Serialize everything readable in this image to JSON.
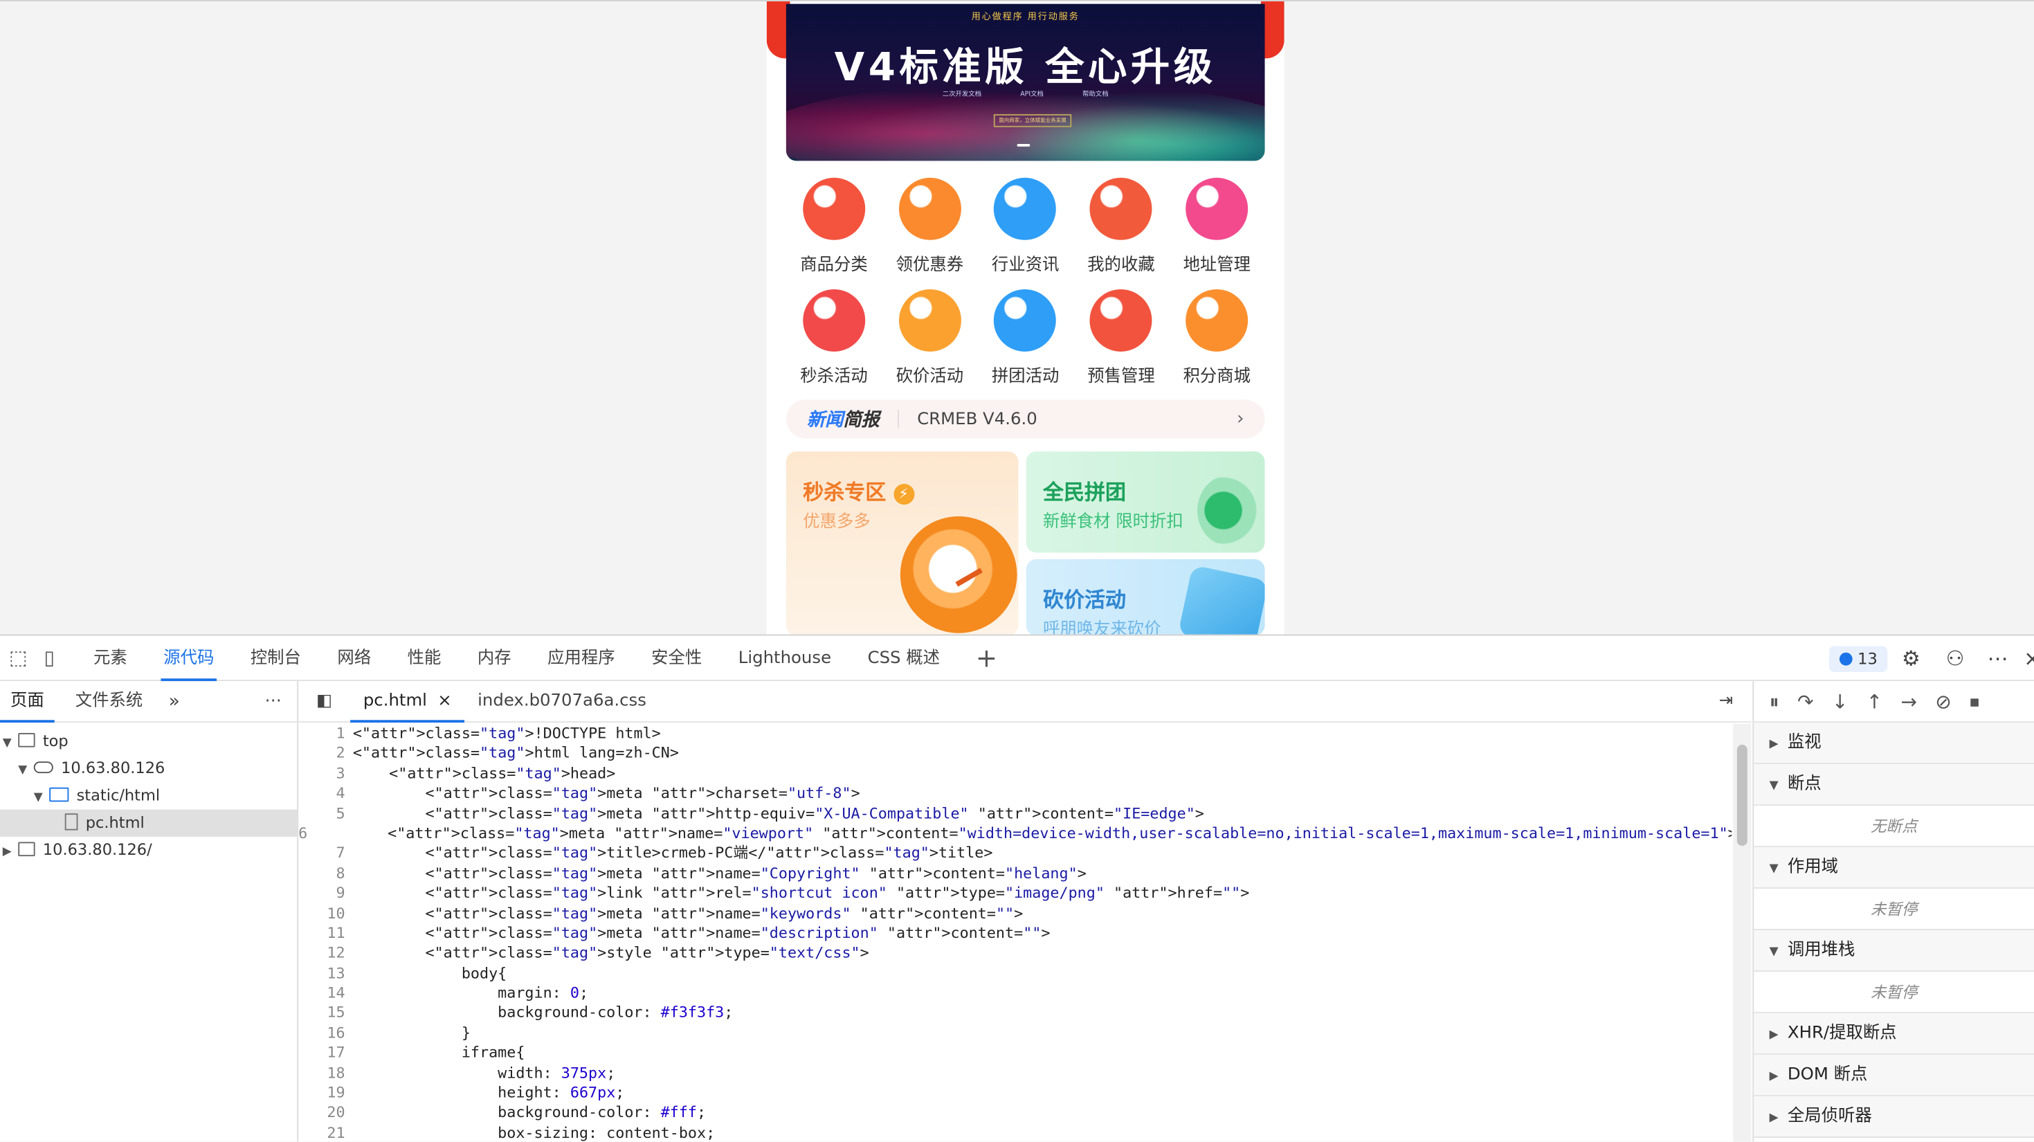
{
  "page": {
    "banner": {
      "slogan": "用心做程序 用行动服务",
      "title": "V4标准版 全心升级",
      "links": [
        "二次开发文档",
        "API文档",
        "帮助文档"
      ],
      "note": "面向商家，立体赋能业务发展"
    },
    "nav_row1": [
      {
        "label": "商品分类",
        "icon": "shopping-bag-icon",
        "color": "#f4533e"
      },
      {
        "label": "领优惠券",
        "icon": "coupon-icon",
        "color": "#fb8a2e"
      },
      {
        "label": "行业资讯",
        "icon": "news-icon",
        "color": "#2e9ef7"
      },
      {
        "label": "我的收藏",
        "icon": "favorite-icon",
        "color": "#f25a3c"
      },
      {
        "label": "地址管理",
        "icon": "location-icon",
        "color": "#f24a8d"
      }
    ],
    "nav_row2": [
      {
        "label": "秒杀活动",
        "icon": "flash-sale-icon",
        "color": "#f24a4a"
      },
      {
        "label": "砍价活动",
        "icon": "bargain-icon",
        "color": "#fba12f"
      },
      {
        "label": "拼团活动",
        "icon": "megaphone-icon",
        "color": "#2e9ef7"
      },
      {
        "label": "预售管理",
        "icon": "diamond-icon",
        "color": "#f2533e"
      },
      {
        "label": "积分商城",
        "icon": "points-store-icon",
        "color": "#fb8f2e"
      }
    ],
    "news": {
      "logo_a": "新闻",
      "logo_b": "简报",
      "text": "CRMEB V4.6.0"
    },
    "cards": {
      "seckill": {
        "title": "秒杀专区",
        "subtitle": "优惠多多",
        "color": "#f07b27"
      },
      "group": {
        "title": "全民拼团",
        "subtitle": "新鲜食材 限时折扣",
        "color": "#1ca15b"
      },
      "bargain": {
        "title": "砍价活动",
        "subtitle": "呼朋唤友来砍价",
        "color": "#2f86d1"
      }
    }
  },
  "devtools": {
    "tabs": [
      "元素",
      "源代码",
      "控制台",
      "网络",
      "性能",
      "内存",
      "应用程序",
      "安全性",
      "Lighthouse",
      "CSS 概述"
    ],
    "active_tab": "源代码",
    "issues_count": "13",
    "navigator": {
      "tabs": [
        "页面",
        "文件系统"
      ],
      "tree": [
        {
          "label": "top",
          "level": 0,
          "icon": "frame",
          "open": true
        },
        {
          "label": "10.63.80.126",
          "level": 1,
          "icon": "cloud",
          "open": true
        },
        {
          "label": "static/html",
          "level": 2,
          "icon": "folder",
          "open": true
        },
        {
          "label": "pc.html",
          "level": 3,
          "icon": "file",
          "selected": true
        },
        {
          "label": "10.63.80.126/",
          "level": 0,
          "icon": "frame",
          "open": false
        }
      ]
    },
    "editor": {
      "tabs": [
        "pc.html",
        "index.b0707a6a.css"
      ],
      "lines": [
        "<!DOCTYPE html>",
        "<html lang=zh-CN>",
        "    <head>",
        "        <meta charset=\"utf-8\">",
        "        <meta http-equiv=\"X-UA-Compatible\" content=\"IE=edge\">",
        "        <meta name=\"viewport\" content=\"width=device-width,user-scalable=no,initial-scale=1,maximum-scale=1,minimum-scale=1\">",
        "        <title>crmeb-PC端</title>",
        "        <meta name=\"Copyright\" content=\"helang\">",
        "        <link rel=\"shortcut icon\" type=\"image/png\" href=\"\">",
        "        <meta name=\"keywords\" content=\"\">",
        "        <meta name=\"description\" content=\"\">",
        "        <style type=\"text/css\">",
        "            body{",
        "                margin: 0;",
        "                background-color: #f3f3f3;",
        "            }",
        "            iframe{",
        "                width: 375px;",
        "                height: 667px;",
        "                background-color: #fff;",
        "                box-sizing: content-box;"
      ]
    },
    "debugger": {
      "sections": [
        {
          "label": "监视",
          "open": false,
          "body": ""
        },
        {
          "label": "断点",
          "open": true,
          "body": "无断点"
        },
        {
          "label": "作用域",
          "open": true,
          "body": "未暂停"
        },
        {
          "label": "调用堆栈",
          "open": true,
          "body": "未暂停"
        },
        {
          "label": "XHR/提取断点",
          "open": false,
          "body": ""
        },
        {
          "label": "DOM 断点",
          "open": false,
          "body": ""
        },
        {
          "label": "全局侦听器",
          "open": false,
          "body": ""
        }
      ]
    }
  }
}
